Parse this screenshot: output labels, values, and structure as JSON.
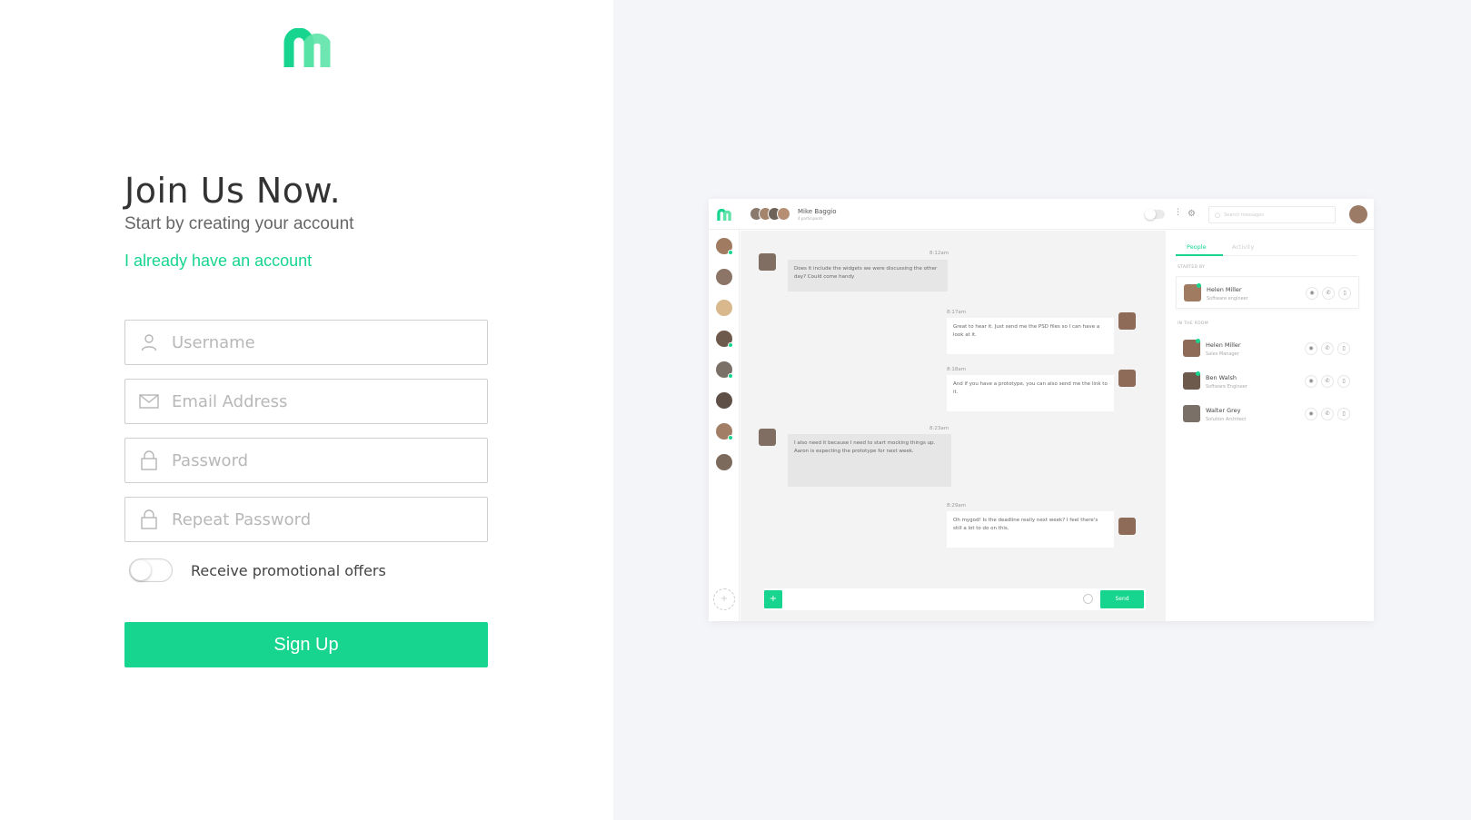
{
  "brand": {
    "accent": "#17d58f"
  },
  "signup": {
    "title": "Join Us Now.",
    "subtitle": "Start by creating your account",
    "login_link": "I already have an account",
    "fields": {
      "username": {
        "placeholder": "Username",
        "icon": "user-icon"
      },
      "email": {
        "placeholder": "Email Address",
        "icon": "envelope-icon"
      },
      "password": {
        "placeholder": "Password",
        "icon": "lock-icon"
      },
      "repeat_password": {
        "placeholder": "Repeat Password",
        "icon": "lock-icon"
      }
    },
    "promo_toggle": {
      "label": "Receive promotional offers",
      "on": false
    },
    "submit_label": "Sign Up"
  },
  "preview": {
    "header": {
      "conversation_name": "Mike Baggio",
      "participants": "4 participants",
      "search_placeholder": "Search messages"
    },
    "messages": [
      {
        "direction": "in",
        "time": "8:12am",
        "text": "Does it include the widgets we were discussing the other day? Could come handy"
      },
      {
        "direction": "out",
        "time": "8:17am",
        "text": "Great to hear it. Just send me the PSD files so I can have a look at it."
      },
      {
        "direction": "out",
        "time": "8:18am",
        "text": "And if you have a prototype, you can also send me the link to it."
      },
      {
        "direction": "in",
        "time": "8:23am",
        "text": "I also need it because I need to start mocking things up. Aaron is expecting the prototype for next week."
      },
      {
        "direction": "out",
        "time": "8:29am",
        "text": "Oh mygod! Is the deadline really next week? I feel there's still a lot to do on this."
      }
    ],
    "composer": {
      "send_label": "Send",
      "plus_label": "+"
    },
    "panel": {
      "tabs": [
        "People",
        "Activity"
      ],
      "started_by_label": "STARTED BY",
      "in_room_label": "IN THE ROOM",
      "started_by": {
        "name": "Helen Miller",
        "role": "Software engineer"
      },
      "in_room": [
        {
          "name": "Helen Miller",
          "role": "Sales Manager"
        },
        {
          "name": "Ben Walsh",
          "role": "Software Engineer"
        },
        {
          "name": "Walter Grey",
          "role": "Solution Architect"
        }
      ]
    }
  }
}
